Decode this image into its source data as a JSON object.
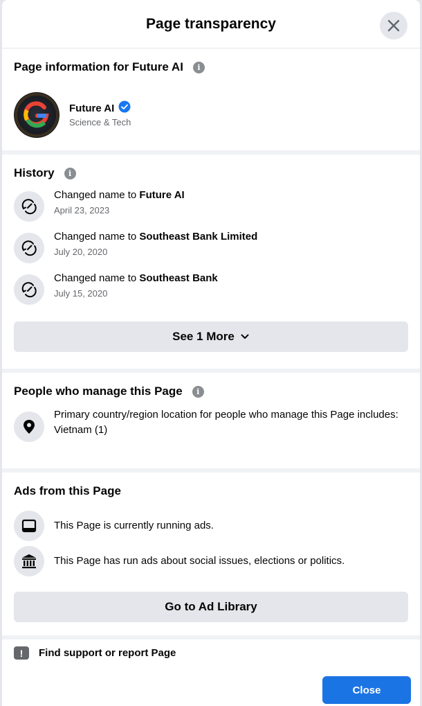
{
  "dialog": {
    "title": "Page transparency",
    "close_label": "Close"
  },
  "page_info": {
    "title": "Page information for Future AI",
    "page_name": "Future AI",
    "category": "Science & Tech",
    "avatar_letter": "G"
  },
  "history": {
    "title": "History",
    "items": [
      {
        "prefix": "Changed name to ",
        "name": "Future AI",
        "date": "April 23, 2023"
      },
      {
        "prefix": "Changed name to ",
        "name": "Southeast Bank Limited",
        "date": "July 20, 2020"
      },
      {
        "prefix": "Changed name to ",
        "name": "Southeast Bank",
        "date": "July 15, 2020"
      }
    ],
    "see_more": "See 1 More"
  },
  "managers": {
    "title": "People who manage this Page",
    "location_text": "Primary country/region location for people who manage this Page includes:",
    "location_value": "Vietnam (1)"
  },
  "ads": {
    "title": "Ads from this Page",
    "running": "This Page is currently running ads.",
    "political": "This Page has run ads about social issues, elections or politics.",
    "library_button": "Go to Ad Library"
  },
  "support": {
    "label": "Find support or report Page"
  },
  "colors": {
    "accent": "#1b74e4",
    "verified": "#1877f2",
    "muted": "#65676b"
  }
}
